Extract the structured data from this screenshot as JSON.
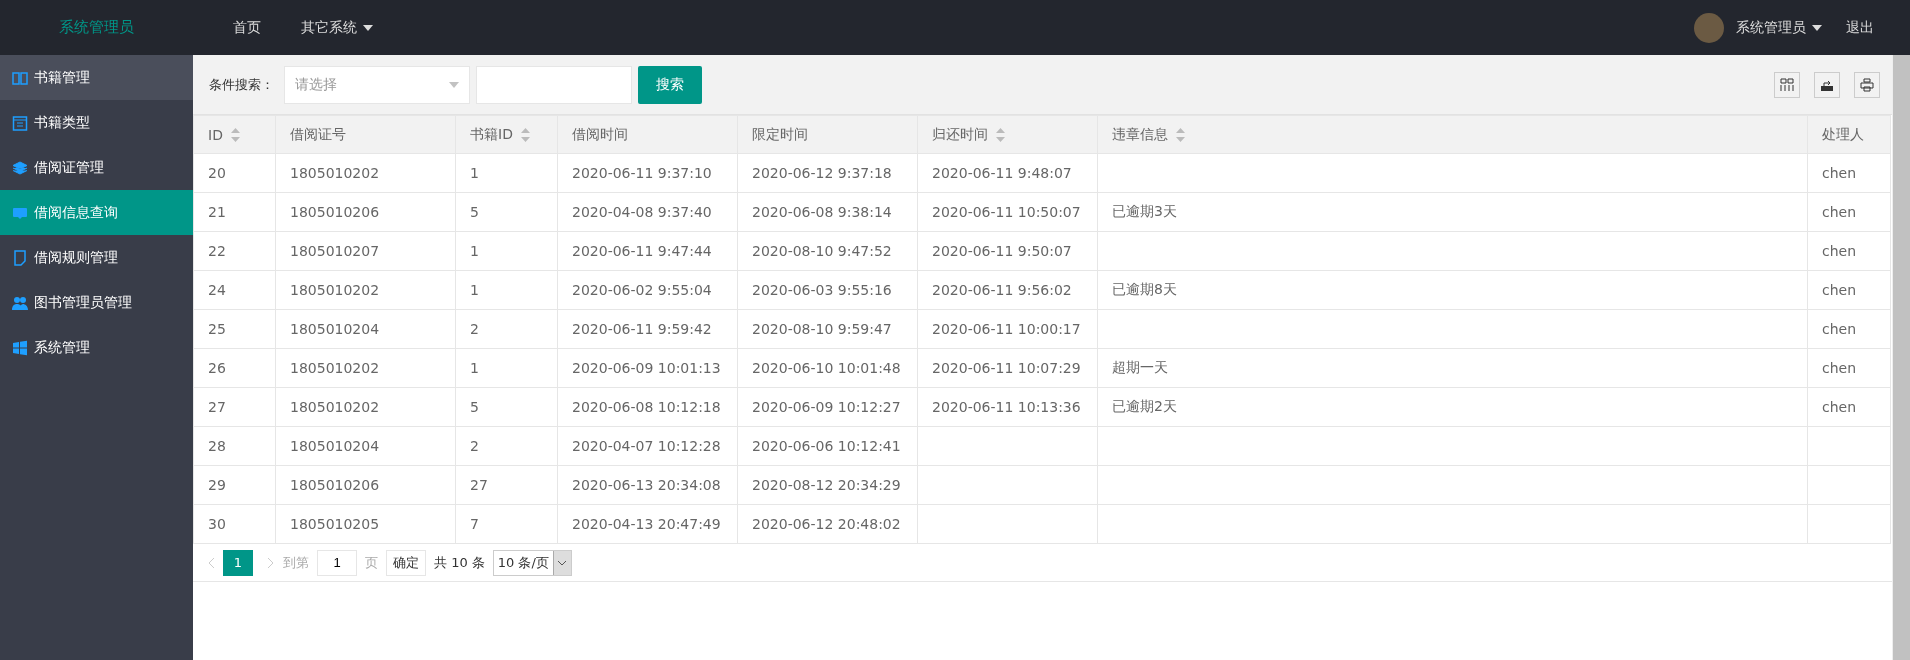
{
  "header": {
    "brand": "系统管理员",
    "nav": [
      {
        "label": "首页",
        "dropdown": false
      },
      {
        "label": "其它系统",
        "dropdown": true
      }
    ],
    "user": {
      "name": "系统管理员"
    },
    "logout": "退出"
  },
  "sidebar": {
    "items": [
      {
        "label": "书籍管理",
        "selected": false,
        "hovered": true
      },
      {
        "label": "书籍类型",
        "selected": false,
        "hovered": false
      },
      {
        "label": "借阅证管理",
        "selected": false,
        "hovered": false
      },
      {
        "label": "借阅信息查询",
        "selected": true,
        "hovered": false
      },
      {
        "label": "借阅规则管理",
        "selected": false,
        "hovered": false
      },
      {
        "label": "图书管理员管理",
        "selected": false,
        "hovered": false
      },
      {
        "label": "系统管理",
        "selected": false,
        "hovered": false
      }
    ]
  },
  "search": {
    "label": "条件搜索：",
    "select_placeholder": "请选择",
    "button": "搜索"
  },
  "table": {
    "columns": [
      {
        "label": "ID",
        "sortable": true
      },
      {
        "label": "借阅证号",
        "sortable": false
      },
      {
        "label": "书籍ID",
        "sortable": true
      },
      {
        "label": "借阅时间",
        "sortable": false
      },
      {
        "label": "限定时间",
        "sortable": false
      },
      {
        "label": "归还时间",
        "sortable": true
      },
      {
        "label": "违章信息",
        "sortable": true
      },
      {
        "label": "处理人",
        "sortable": false
      }
    ],
    "rows": [
      [
        "20",
        "1805010202",
        "1",
        "2020-06-11 9:37:10",
        "2020-06-12 9:37:18",
        "2020-06-11 9:48:07",
        "",
        "chen"
      ],
      [
        "21",
        "1805010206",
        "5",
        "2020-04-08 9:37:40",
        "2020-06-08 9:38:14",
        "2020-06-11 10:50:07",
        "已逾期3天",
        "chen"
      ],
      [
        "22",
        "1805010207",
        "1",
        "2020-06-11 9:47:44",
        "2020-08-10 9:47:52",
        "2020-06-11 9:50:07",
        "",
        "chen"
      ],
      [
        "24",
        "1805010202",
        "1",
        "2020-06-02 9:55:04",
        "2020-06-03 9:55:16",
        "2020-06-11 9:56:02",
        "已逾期8天",
        "chen"
      ],
      [
        "25",
        "1805010204",
        "2",
        "2020-06-11 9:59:42",
        "2020-08-10 9:59:47",
        "2020-06-11 10:00:17",
        "",
        "chen"
      ],
      [
        "26",
        "1805010202",
        "1",
        "2020-06-09 10:01:13",
        "2020-06-10 10:01:48",
        "2020-06-11 10:07:29",
        "超期一天",
        "chen"
      ],
      [
        "27",
        "1805010202",
        "5",
        "2020-06-08 10:12:18",
        "2020-06-09 10:12:27",
        "2020-06-11 10:13:36",
        "已逾期2天",
        "chen"
      ],
      [
        "28",
        "1805010204",
        "2",
        "2020-04-07 10:12:28",
        "2020-06-06 10:12:41",
        "",
        "",
        ""
      ],
      [
        "29",
        "1805010206",
        "27",
        "2020-06-13 20:34:08",
        "2020-08-12 20:34:29",
        "",
        "",
        ""
      ],
      [
        "30",
        "1805010205",
        "7",
        "2020-04-13 20:47:49",
        "2020-06-12 20:48:02",
        "",
        "",
        ""
      ]
    ]
  },
  "pagination": {
    "pages": [
      {
        "label": "1",
        "selected": true
      }
    ],
    "goto_label": "到第",
    "page_value": "1",
    "page_unit": "页",
    "confirm": "确定",
    "total": "共 10 条",
    "page_size": "10 条/页"
  }
}
